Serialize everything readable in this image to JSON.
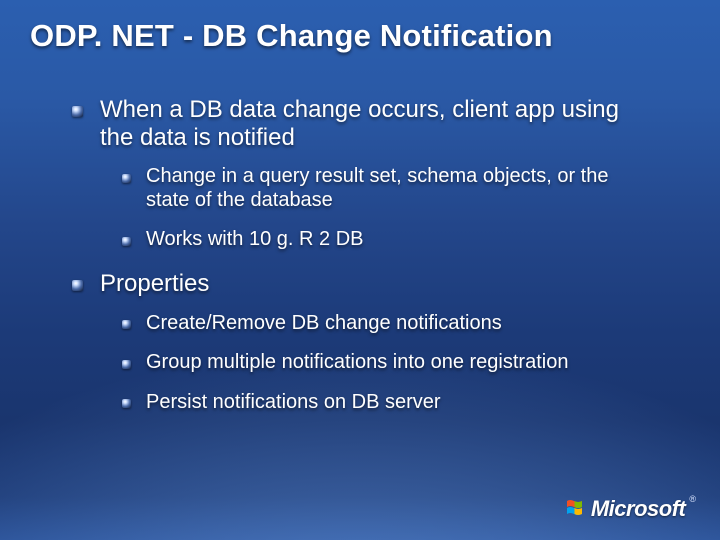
{
  "title": "ODP. NET - DB Change Notification",
  "bullets": [
    {
      "text": "When a DB data change occurs, client app using the data is notified",
      "children": [
        "Change in a query result set, schema objects, or the state of the database",
        "Works with 10 g. R 2 DB"
      ]
    },
    {
      "text": "Properties",
      "children": [
        "Create/Remove DB change notifications",
        "Group multiple notifications into one registration",
        "Persist notifications on DB server"
      ]
    }
  ],
  "logo": {
    "text": "Microsoft",
    "tm": "®"
  }
}
